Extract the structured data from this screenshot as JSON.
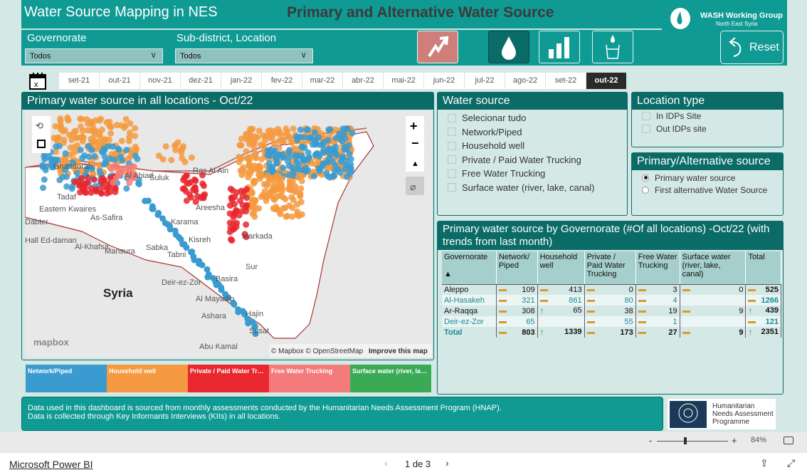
{
  "header": {
    "app_title": "Water Source Mapping in NES",
    "main_title": "Primary and Alternative Water Source",
    "logo_title": "WASH Working Group",
    "logo_subtitle": "North East Syria",
    "reset_label": "Reset"
  },
  "filters": {
    "governorate_label": "Governorate",
    "governorate_value": "Todos",
    "subdistrict_label": "Sub-district, Location",
    "subdistrict_value": "Todos"
  },
  "nav_icons": [
    "trend-icon",
    "water-drop-icon",
    "bar-chart-icon",
    "water-glass-icon"
  ],
  "dates": [
    "set-21",
    "out-21",
    "nov-21",
    "dez-21",
    "jan-22",
    "fev-22",
    "mar-22",
    "abr-22",
    "mai-22",
    "jun-22",
    "jul-22",
    "ago-22",
    "set-22",
    "out-22"
  ],
  "selected_date": "out-22",
  "map": {
    "title": "Primary water source in all locations - Oct/22",
    "country_label": "Syria",
    "labels": [
      "Ghandorah",
      "Al Abiad",
      "Ras Al Ain",
      "Suluk",
      "Tadaf",
      "Eastern Kwaires",
      "As-Safira",
      "Dabter",
      "Hall Ed-daman",
      "Al-Khafsa",
      "Mansura",
      "Sabka",
      "Karama",
      "Areesha",
      "Kisreh",
      "Tabni",
      "Markada",
      "Sur",
      "Basira",
      "Deir-ez-Zor",
      "Al Mayadin",
      "Hajin",
      "Ashara",
      "Susat",
      "Abu Kamal"
    ],
    "attribution": "© Mapbox © OpenStreetMap",
    "improve_link": "Improve this map",
    "brand": "mapbox"
  },
  "legend": [
    {
      "label": "Network/Piped",
      "color": "#3a9bd0"
    },
    {
      "label": "Household well",
      "color": "#f59a40"
    },
    {
      "label": "Private / Paid Water Trucking",
      "color": "#e8272f"
    },
    {
      "label": "Free Water Trucking",
      "color": "#f47b7b"
    },
    {
      "label": "Surface water (river, lake, canal)",
      "color": "#3aaa55"
    }
  ],
  "water_source": {
    "title": "Water source",
    "options": [
      "Selecionar tudo",
      "Network/Piped",
      "Household well",
      "Private / Paid Water Trucking",
      "Free Water Trucking",
      "Surface water (river, lake, canal)"
    ]
  },
  "location_type": {
    "title": "Location type",
    "options": [
      "In IDPs Site",
      "Out IDPs site"
    ]
  },
  "primary_alt": {
    "title": "Primary/Alternative source",
    "options": [
      "Primary water source",
      "First alternative Water Source"
    ],
    "selected": 0
  },
  "table": {
    "title": "Primary water source by Governorate (#Of all locations) -Oct/22 (with trends from last month)",
    "columns": [
      "Governorate",
      "Network/ Piped",
      "Household well",
      "Private / Paid Water Trucking",
      "Free Water Trucking",
      "Surface water (river, lake, canal)",
      "Total"
    ],
    "rows": [
      {
        "name": "Aleppo",
        "cells": [
          [
            "flat",
            "109"
          ],
          [
            "flat",
            "413"
          ],
          [
            "flat",
            "0"
          ],
          [
            "flat",
            "3"
          ],
          [
            "flat",
            "0"
          ],
          [
            "flat",
            "525"
          ]
        ]
      },
      {
        "name": "Al-Hasakeh",
        "cells": [
          [
            "flat",
            "321"
          ],
          [
            "flat",
            "861"
          ],
          [
            "flat",
            "80"
          ],
          [
            "flat",
            "4"
          ],
          [
            "",
            ""
          ],
          [
            "flat",
            "1266"
          ]
        ]
      },
      {
        "name": "Ar-Raqqa",
        "cells": [
          [
            "flat",
            "308"
          ],
          [
            "up",
            "65"
          ],
          [
            "flat",
            "38"
          ],
          [
            "flat",
            "19"
          ],
          [
            "flat",
            "9"
          ],
          [
            "up",
            "439"
          ]
        ]
      },
      {
        "name": "Deir-ez-Zor",
        "cells": [
          [
            "flat",
            "65"
          ],
          [
            "",
            ""
          ],
          [
            "flat",
            "55"
          ],
          [
            "flat",
            "1"
          ],
          [
            "",
            ""
          ],
          [
            "flat",
            "121"
          ]
        ]
      },
      {
        "name": "Total",
        "cells": [
          [
            "flat",
            "803"
          ],
          [
            "up",
            "1339"
          ],
          [
            "flat",
            "173"
          ],
          [
            "flat",
            "27"
          ],
          [
            "flat",
            "9"
          ],
          [
            "up",
            "2351"
          ]
        ]
      }
    ]
  },
  "note": {
    "line1": "Data used in this dashboard is sourced from monthly assessments conducted by the Humanitarian Needs Assessment Program (HNAP).",
    "line2": "Data is collected through Key Informants Interviews (KIIs) in all locations."
  },
  "hnap": {
    "line1": "Humanitarian",
    "line2": "Needs Assessment",
    "line3": "Programme"
  },
  "footer": {
    "zoom": "84%",
    "brand": "Microsoft Power BI",
    "page": "1 de 3"
  }
}
